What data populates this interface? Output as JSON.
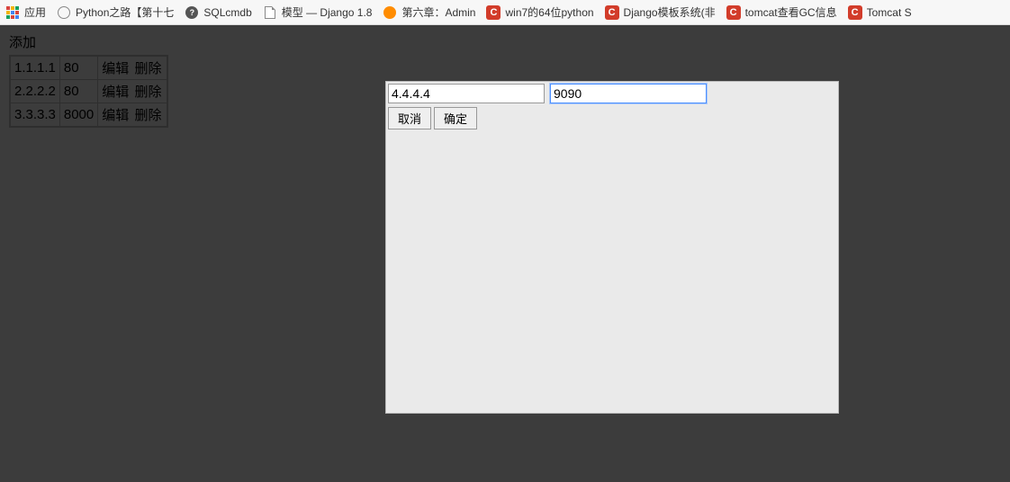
{
  "bookmarks": [
    {
      "icon": "apps",
      "label": "应用"
    },
    {
      "icon": "snake",
      "label": "Python之路【第十七"
    },
    {
      "icon": "gray-circle",
      "glyph": "?",
      "label": "SQLcmdb"
    },
    {
      "icon": "page",
      "label": "模型 — Django 1.8"
    },
    {
      "icon": "orange",
      "label": "第六章：Admin"
    },
    {
      "icon": "c",
      "label": "win7的64位python"
    },
    {
      "icon": "c",
      "label": "Django模板系统(非"
    },
    {
      "icon": "c",
      "label": "tomcat查看GC信息"
    },
    {
      "icon": "c",
      "label": "Tomcat S"
    }
  ],
  "page": {
    "add_label": "添加",
    "edit_label": "编辑",
    "delete_label": "删除",
    "rows": [
      {
        "ip": "1.1.1.1",
        "port": "80"
      },
      {
        "ip": "2.2.2.2",
        "port": "80"
      },
      {
        "ip": "3.3.3.3",
        "port": "8000"
      }
    ]
  },
  "modal": {
    "ip_value": "4.4.4.4",
    "port_value": "9090",
    "cancel_label": "取消",
    "ok_label": "确定"
  }
}
